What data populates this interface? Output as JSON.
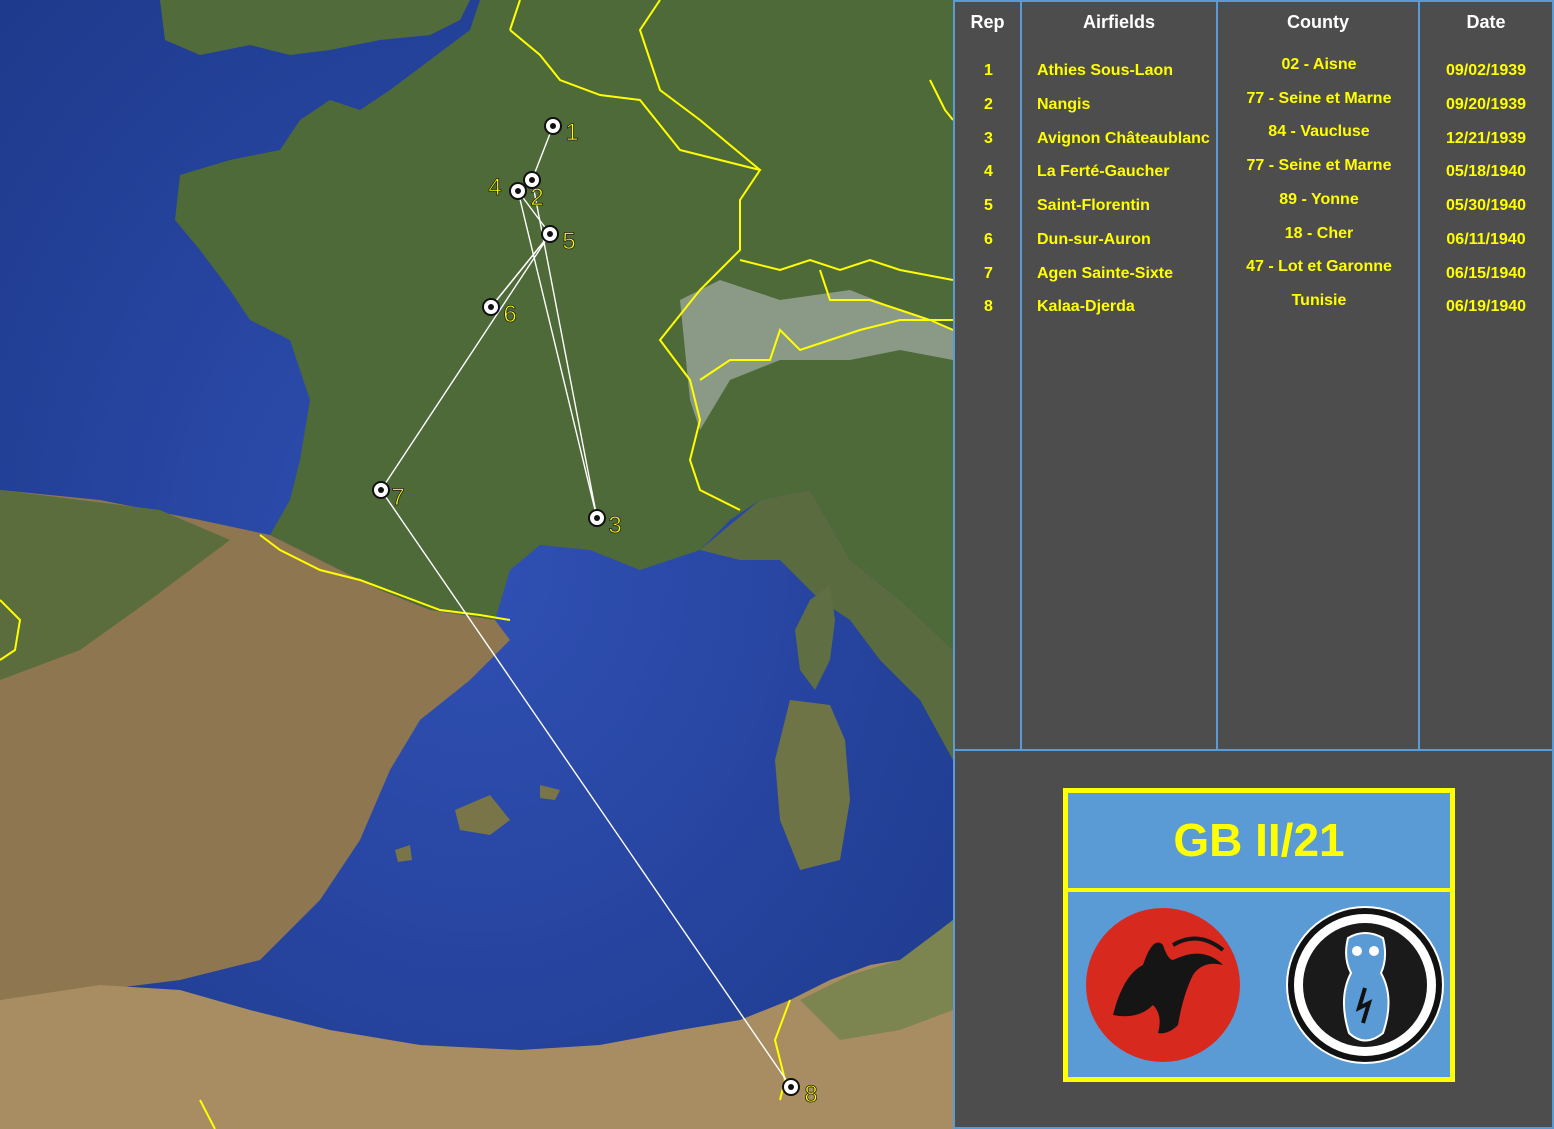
{
  "table": {
    "headers": {
      "rep": "Rep",
      "airfields": "Airfields",
      "county": "County",
      "date": "Date"
    },
    "rows": [
      {
        "rep": "1",
        "airfield": "Athies Sous-Laon",
        "county": "02 - Aisne",
        "date": "09/02/1939"
      },
      {
        "rep": "2",
        "airfield": "Nangis",
        "county": "77 - Seine et Marne",
        "date": "09/20/1939"
      },
      {
        "rep": "3",
        "airfield": "Avignon Châteaublanc",
        "county": "84 - Vaucluse",
        "date": "12/21/1939"
      },
      {
        "rep": "4",
        "airfield": "La Ferté-Gaucher",
        "county": "77 - Seine et Marne",
        "date": "05/18/1940"
      },
      {
        "rep": "5",
        "airfield": "Saint-Florentin",
        "county": "89 - Yonne",
        "date": "05/30/1940"
      },
      {
        "rep": "6",
        "airfield": "Dun-sur-Auron",
        "county": "18 - Cher",
        "date": "06/11/1940"
      },
      {
        "rep": "7",
        "airfield": "Agen Sainte-Sixte",
        "county": "47 - Lot et Garonne",
        "date": "06/15/1940"
      },
      {
        "rep": "8",
        "airfield": "Kalaa-Djerda",
        "county": "Tunisie",
        "date": "06/19/1940"
      }
    ]
  },
  "badge": {
    "title": "GB II/21",
    "insignia": [
      "red-bird-insignia",
      "black-owl-insignia"
    ]
  },
  "map": {
    "markers": [
      "1",
      "2",
      "3",
      "4",
      "5",
      "6",
      "7",
      "8"
    ],
    "route_order": [
      "1",
      "2",
      "3",
      "4",
      "5",
      "6",
      "7",
      "8"
    ],
    "colors": {
      "route": "#ffffff",
      "label": "#ffff00",
      "border": "#ffff00",
      "sea": "#2b48a8",
      "land": "#4f6b3a"
    }
  }
}
